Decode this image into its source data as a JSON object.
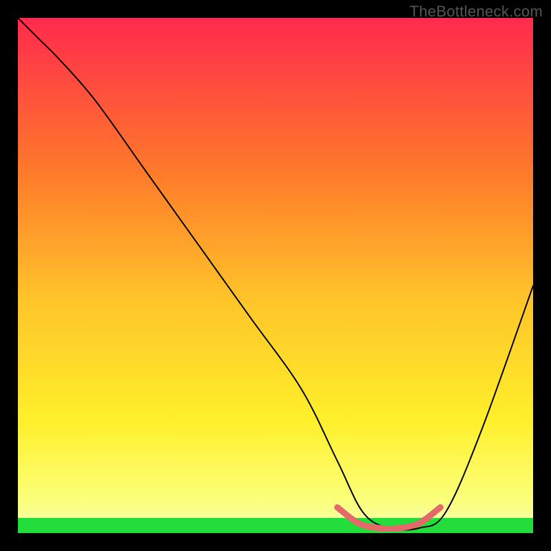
{
  "watermark": "TheBottleneck.com",
  "colors": {
    "frame_bg": "#000000",
    "gradient_top": "#ff2a4d",
    "gradient_mid1": "#ff8a2a",
    "gradient_mid2": "#ffe92a",
    "gradient_bottom_yellow": "#fdff8a",
    "green_band": "#22dd3a",
    "curve_stroke": "#000000",
    "trough_highlight": "#e46a6a"
  },
  "chart_data": {
    "type": "line",
    "title": "",
    "xlabel": "",
    "ylabel": "",
    "x_range": [
      0,
      100
    ],
    "y_range": [
      0,
      100
    ],
    "y_axis_inverted_note": "higher plotted = lower y; curve y is bottleneck %",
    "series": [
      {
        "name": "bottleneck-curve",
        "x": [
          0,
          4,
          8,
          15,
          25,
          35,
          45,
          55,
          62,
          67,
          72,
          78,
          83,
          90,
          100
        ],
        "y": [
          100,
          96,
          92,
          84,
          70,
          56,
          42,
          28,
          14,
          4,
          1,
          1,
          4,
          20,
          48
        ]
      }
    ],
    "highlight": {
      "name": "optimal-range",
      "x": [
        62,
        66,
        70,
        74,
        78,
        82
      ],
      "y": [
        5,
        2,
        1,
        1,
        2,
        5
      ]
    },
    "green_band_y_range": [
      0,
      3
    ]
  }
}
